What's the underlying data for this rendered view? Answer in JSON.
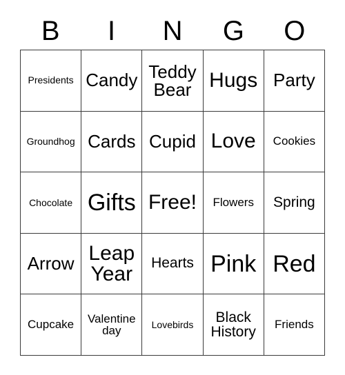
{
  "card": {
    "title_letters": [
      "B",
      "I",
      "N",
      "G",
      "O"
    ],
    "free_space": "Free!",
    "colors": {
      "background": "#ffffff",
      "grid_line": "#3a3a3a",
      "text": "#000000"
    },
    "grid": {
      "columns": 5,
      "rows": 5,
      "cells": [
        [
          {
            "label": "Presidents",
            "size": "fs-xs",
            "lines": 1
          },
          {
            "label": "Candy",
            "size": "fs-l",
            "lines": 1
          },
          {
            "label": "Teddy Bear",
            "size": "fs-l",
            "lines": 2
          },
          {
            "label": "Hugs",
            "size": "fs-xl",
            "lines": 1
          },
          {
            "label": "Party",
            "size": "fs-l",
            "lines": 1
          }
        ],
        [
          {
            "label": "Groundhog",
            "size": "fs-xs",
            "lines": 1
          },
          {
            "label": "Cards",
            "size": "fs-l",
            "lines": 1
          },
          {
            "label": "Cupid",
            "size": "fs-l",
            "lines": 1
          },
          {
            "label": "Love",
            "size": "fs-xl",
            "lines": 1
          },
          {
            "label": "Cookies",
            "size": "fs-s",
            "lines": 1
          }
        ],
        [
          {
            "label": "Chocolate",
            "size": "fs-xs",
            "lines": 1
          },
          {
            "label": "Gifts",
            "size": "fs-xxl",
            "lines": 1
          },
          {
            "label": "Free!",
            "size": "fs-xl",
            "lines": 1
          },
          {
            "label": "Flowers",
            "size": "fs-s",
            "lines": 1
          },
          {
            "label": "Spring",
            "size": "fs-m",
            "lines": 1
          }
        ],
        [
          {
            "label": "Arrow",
            "size": "fs-l",
            "lines": 1
          },
          {
            "label": "Leap Year",
            "size": "fs-xl",
            "lines": 2
          },
          {
            "label": "Hearts",
            "size": "fs-m",
            "lines": 1
          },
          {
            "label": "Pink",
            "size": "fs-xxl",
            "lines": 1
          },
          {
            "label": "Red",
            "size": "fs-xxl",
            "lines": 1
          }
        ],
        [
          {
            "label": "Cupcake",
            "size": "fs-s",
            "lines": 1
          },
          {
            "label": "Valentine day",
            "size": "fs-s",
            "lines": 2
          },
          {
            "label": "Lovebirds",
            "size": "fs-xs",
            "lines": 1
          },
          {
            "label": "Black History",
            "size": "fs-m",
            "lines": 2
          },
          {
            "label": "Friends",
            "size": "fs-s",
            "lines": 1
          }
        ]
      ]
    }
  }
}
